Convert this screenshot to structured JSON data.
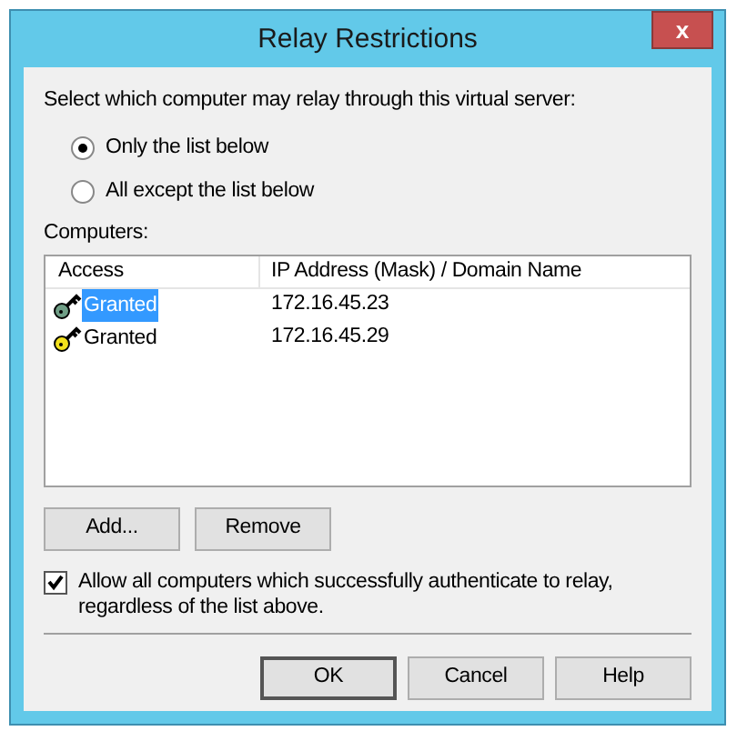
{
  "window": {
    "title": "Relay Restrictions",
    "close": "x"
  },
  "prompt": "Select which computer may relay through this virtual server:",
  "options": [
    {
      "label": "Only the list below",
      "selected": true
    },
    {
      "label": "All except the list below",
      "selected": false
    }
  ],
  "computers": {
    "label": "Computers:",
    "columns": [
      "Access",
      "IP Address (Mask) / Domain Name"
    ],
    "rows": [
      {
        "access": "Granted",
        "address": "172.16.45.23",
        "color": "#6f9e86",
        "selected": true
      },
      {
        "access": "Granted",
        "address": "172.16.45.29",
        "color": "#f2e01c",
        "selected": false
      }
    ]
  },
  "list_buttons": [
    "Add...",
    "Remove"
  ],
  "allow_authenticated": {
    "label": "Allow all computers which successfully authenticate to relay, regardless of the list above.",
    "checked": true
  },
  "buttons": [
    {
      "label": "OK",
      "default": true
    },
    {
      "label": "Cancel",
      "default": false
    },
    {
      "label": "Help",
      "default": false
    }
  ]
}
